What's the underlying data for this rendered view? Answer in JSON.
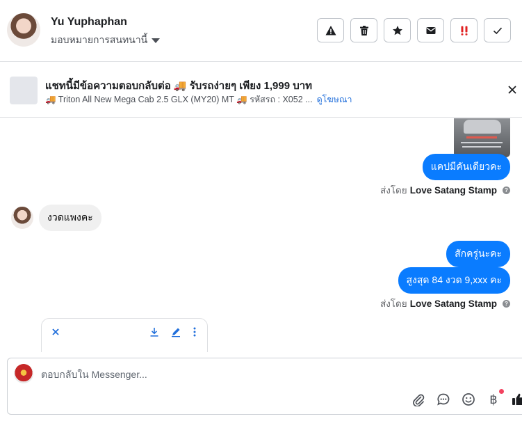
{
  "header": {
    "user_name": "Yu Yuphaphan",
    "assign_label": "มอบหมายการสนทนานี้",
    "actions": [
      "report-icon",
      "trash-icon",
      "star-icon",
      "mail-icon",
      "spam-icon",
      "check-icon"
    ]
  },
  "ad_context": {
    "title": "แชทนี้มีข้อความตอบกลับต่อ 🚚 รับรถง่ายๆ เพียง 1,999 บาท",
    "subtitle": "🚚 Triton All New Mega Cab 2.5 GLX (MY20) MT 🚚 รหัสรถ : X052 ...",
    "link": "ดูโฆษณา"
  },
  "messages": [
    {
      "from": "page",
      "text": "แคปมีคันเดียวคะ"
    },
    {
      "from": "page_meta",
      "prefix": "ส่งโดย",
      "sender": "Love Satang Stamp"
    },
    {
      "from": "user",
      "text": "งวดแพงคะ"
    },
    {
      "from": "page",
      "text": "สักครู่นะคะ"
    },
    {
      "from": "page",
      "text": "สูงสุด 84 งวด 9,xxx คะ"
    },
    {
      "from": "page_meta",
      "prefix": "ส่งโดย",
      "sender": "Love Satang Stamp"
    }
  ],
  "composer": {
    "placeholder": "ตอบกลับใน Messenger...",
    "tools": [
      "paperclip-icon",
      "chat-bubble-icon",
      "emoji-icon",
      "baht-icon",
      "thumbs-up-icon"
    ],
    "baht_symbol": "฿"
  },
  "colors": {
    "accent": "#0a7cff",
    "link": "#216fdb",
    "spam": "#e02020",
    "notification": "#f3425f"
  }
}
